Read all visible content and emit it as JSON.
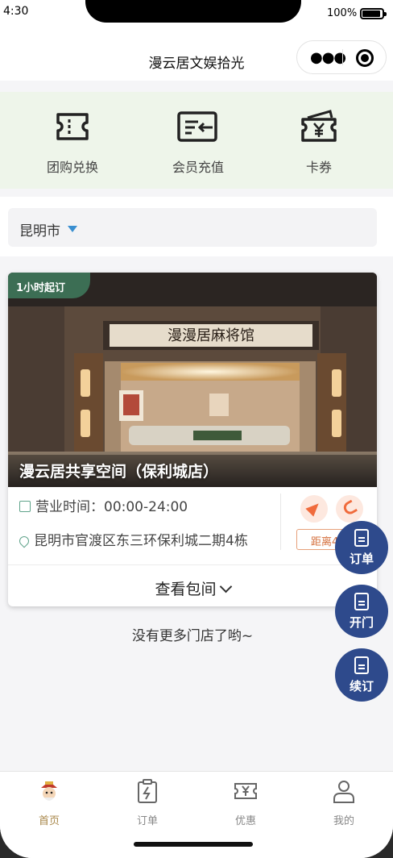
{
  "status_bar": {
    "time": "4:30",
    "battery": "100%"
  },
  "nav": {
    "title": "漫云居文娱拾光"
  },
  "quick_actions": [
    {
      "label": "团购兑换",
      "icon": "ticket-icon"
    },
    {
      "label": "会员充值",
      "icon": "card-recharge-icon"
    },
    {
      "label": "卡券",
      "icon": "coupon-icon"
    }
  ],
  "city": {
    "name": "昆明市"
  },
  "store": {
    "tag": "1小时起订",
    "sign_text": "漫漫居麻将馆",
    "name": "漫云居共享空间（保利城店）",
    "hours": "营业时间：00:00-24:00",
    "address": "昆明市官渡区东三环保利城二期4栋",
    "distance": "距离4",
    "view_rooms": "查看包间"
  },
  "no_more": "没有更多门店了哟~",
  "fabs": [
    {
      "label": "订单"
    },
    {
      "label": "开门"
    },
    {
      "label": "续订"
    }
  ],
  "tabs": [
    {
      "label": "首页",
      "active": true
    },
    {
      "label": "订单",
      "active": false
    },
    {
      "label": "优惠",
      "active": false
    },
    {
      "label": "我的",
      "active": false
    }
  ],
  "colors": {
    "accent": "#2e4a8c",
    "tag_green": "#3c6e54",
    "quick_bg": "#eef5ea",
    "active_tab": "#a8874a",
    "orange": "#f06b3c"
  }
}
